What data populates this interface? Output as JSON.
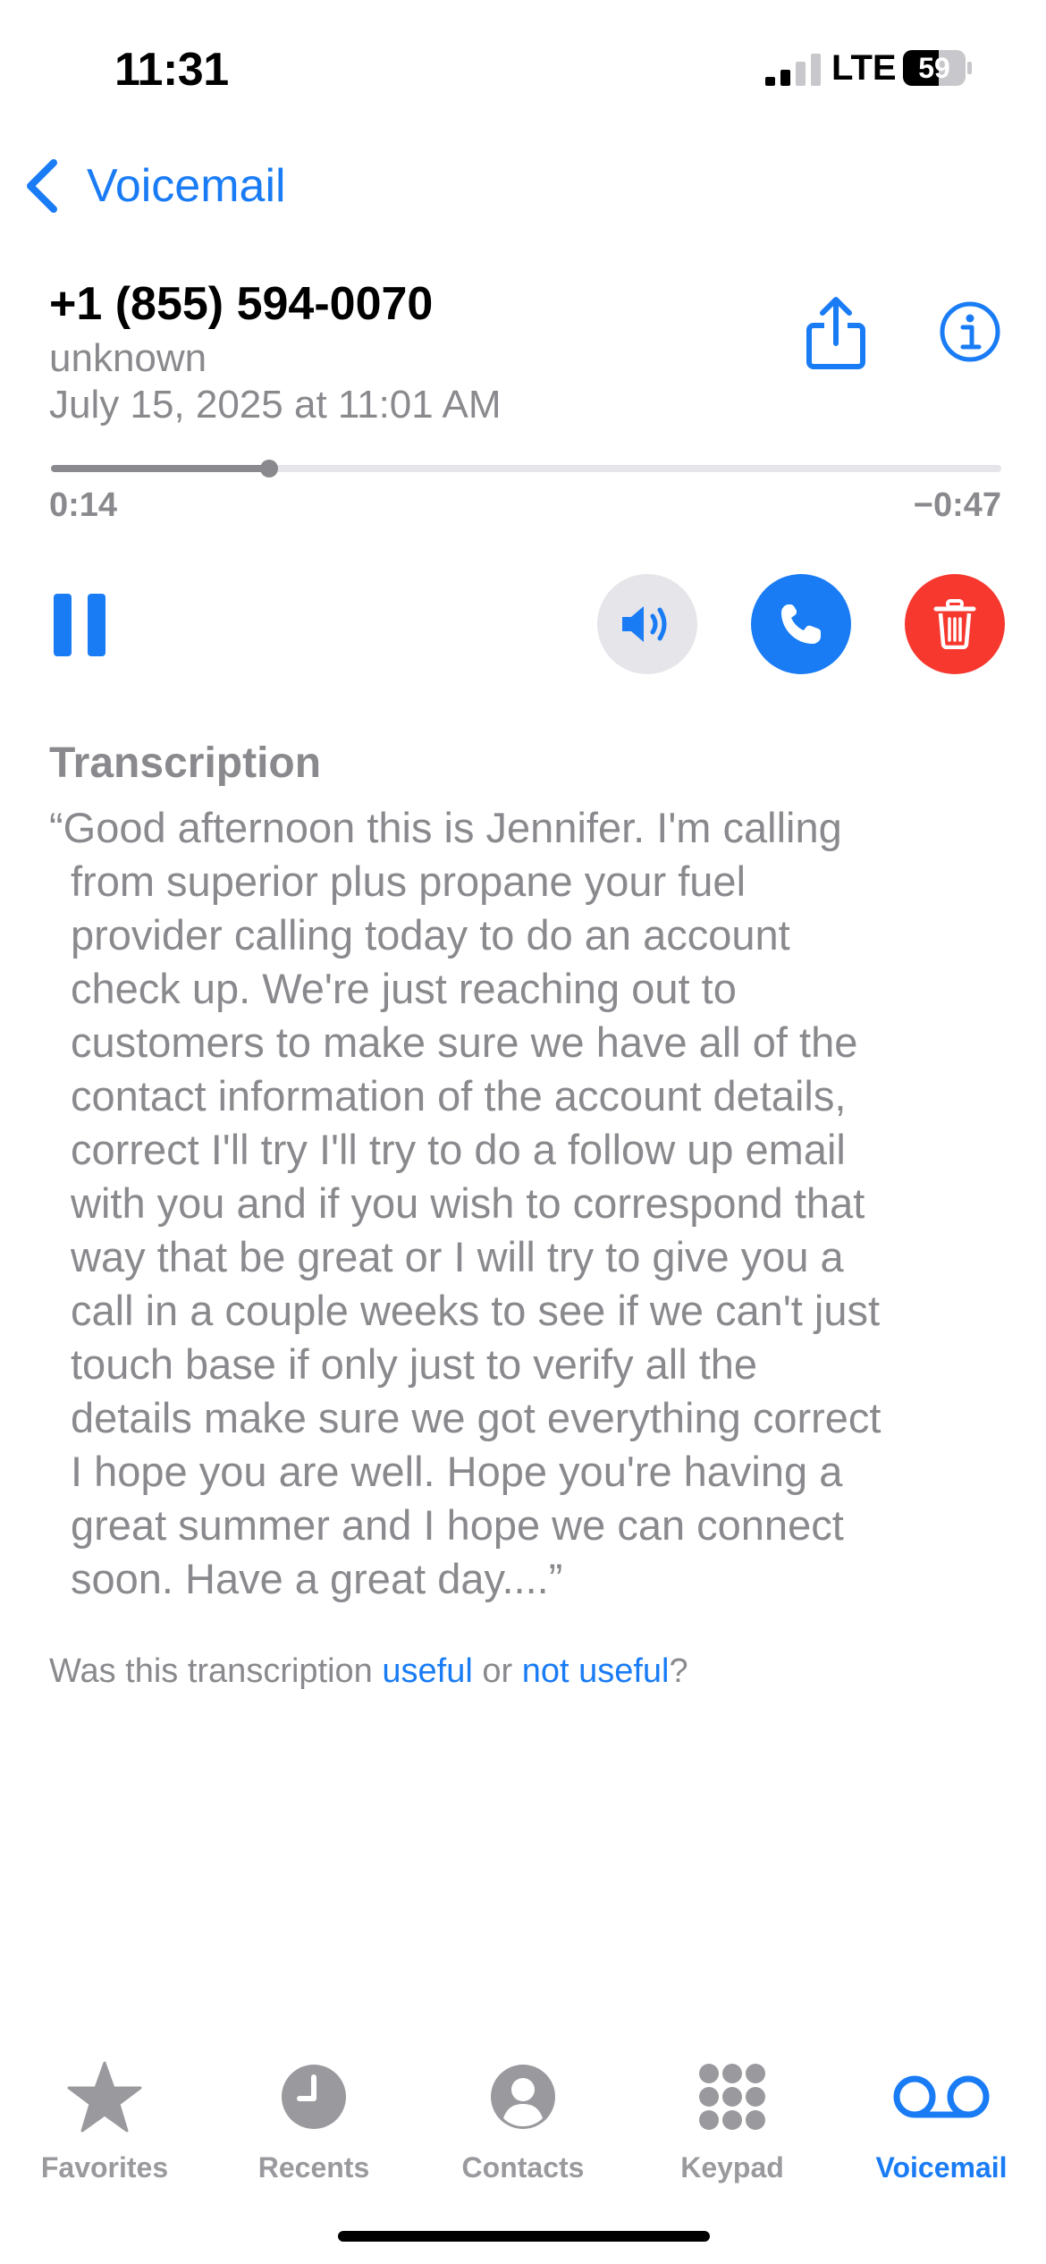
{
  "status_bar": {
    "time": "11:31",
    "network": "LTE",
    "battery": "59"
  },
  "nav": {
    "back_label": "Voicemail"
  },
  "header": {
    "phone_number": "+1 (855) 594-0070",
    "subtitle": "unknown",
    "datetime": "July 15, 2025 at 11:01 AM"
  },
  "player": {
    "elapsed": "0:14",
    "remaining": "−0:47",
    "progress": 0.23
  },
  "transcription": {
    "heading": "Transcription",
    "lines": [
      "“Good afternoon this is Jennifer. I'm calling",
      "from superior plus propane your fuel",
      "provider calling today to do an account",
      "check up. We're just reaching out to",
      "customers to make sure we have all of the",
      "contact information of the account details,",
      "correct I'll try I'll try to do a follow up email",
      "with you and if you wish to correspond that",
      "way that be great or I will try to give you a",
      "call in a couple weeks to see if we can't just",
      "touch base if only just to verify all the",
      "details make sure we got everything correct",
      "I hope you are well. Hope you're having a",
      "great summer and I hope we can connect",
      "soon. Have a great day....”"
    ],
    "feedback_prefix": "Was this transcription ",
    "useful_label": "useful",
    "or_label": " or ",
    "not_useful_label": "not useful",
    "feedback_suffix": "?"
  },
  "tabs": [
    {
      "label": "Favorites",
      "icon": "star-icon"
    },
    {
      "label": "Recents",
      "icon": "clock-icon"
    },
    {
      "label": "Contacts",
      "icon": "person-icon"
    },
    {
      "label": "Keypad",
      "icon": "keypad-icon"
    },
    {
      "label": "Voicemail",
      "icon": "voicemail-icon",
      "active": true
    }
  ],
  "colors": {
    "accent": "#1a7cf5",
    "destructive": "#f6382f",
    "secondary_text": "#8a8a8e"
  }
}
